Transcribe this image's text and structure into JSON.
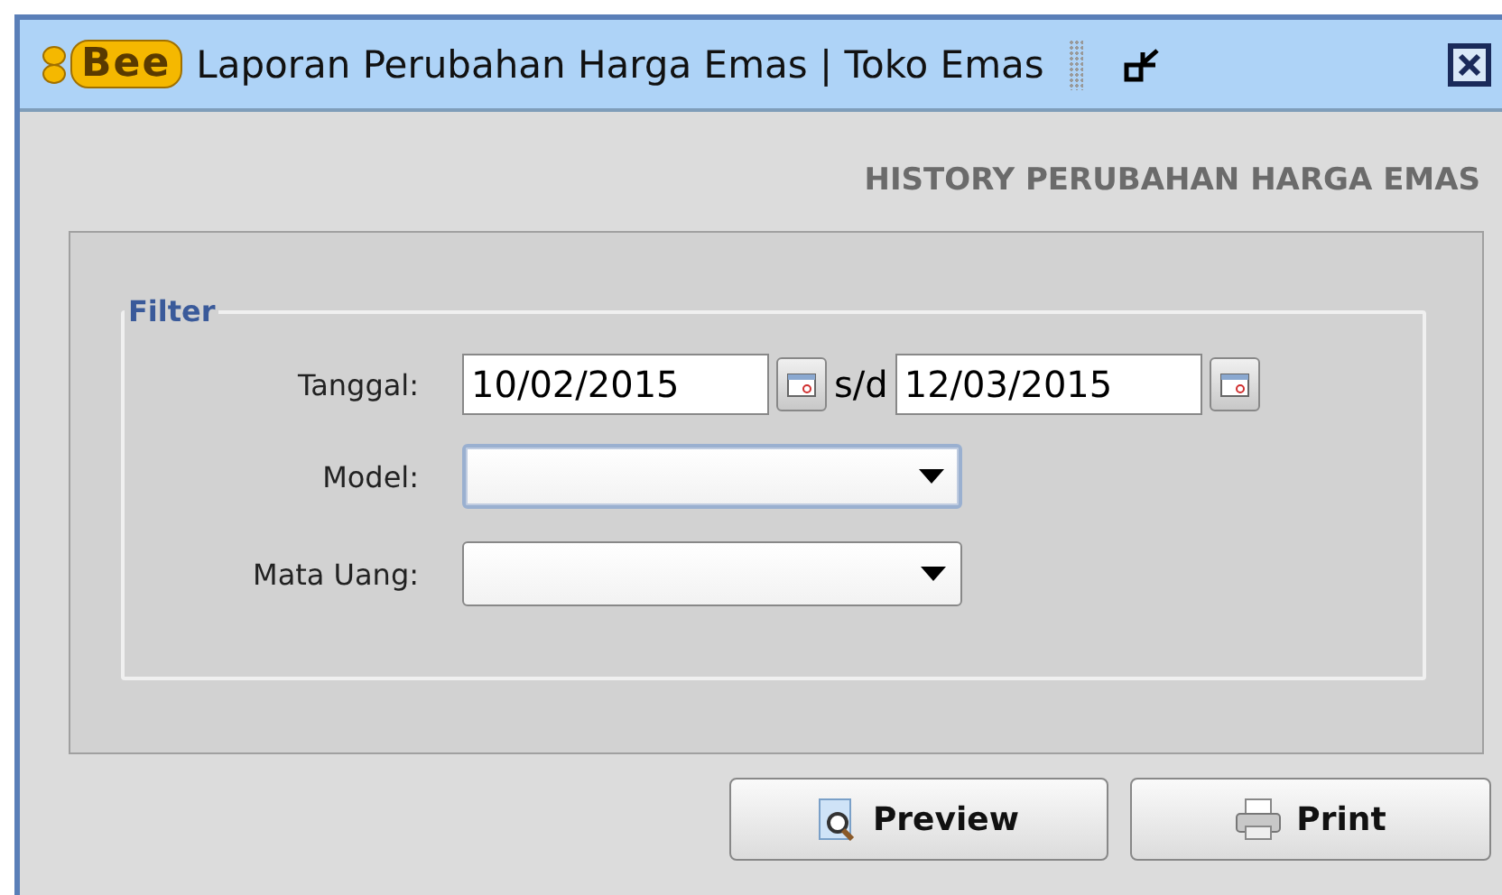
{
  "window": {
    "logo": "Bee",
    "title": "Laporan Perubahan Harga Emas | Toko Emas"
  },
  "heading": "HISTORY PERUBAHAN HARGA EMAS",
  "filter": {
    "legend": "Filter",
    "date": {
      "label": "Tanggal:",
      "from": "10/02/2015",
      "separator": "s/d",
      "to": "12/03/2015"
    },
    "combos": [
      {
        "label": "Model:",
        "focused": true
      },
      {
        "label": "Mata Uang:",
        "focused": false
      }
    ]
  },
  "buttons": [
    {
      "kind": "preview",
      "label": "Preview"
    },
    {
      "kind": "print",
      "label": "Print"
    }
  ]
}
